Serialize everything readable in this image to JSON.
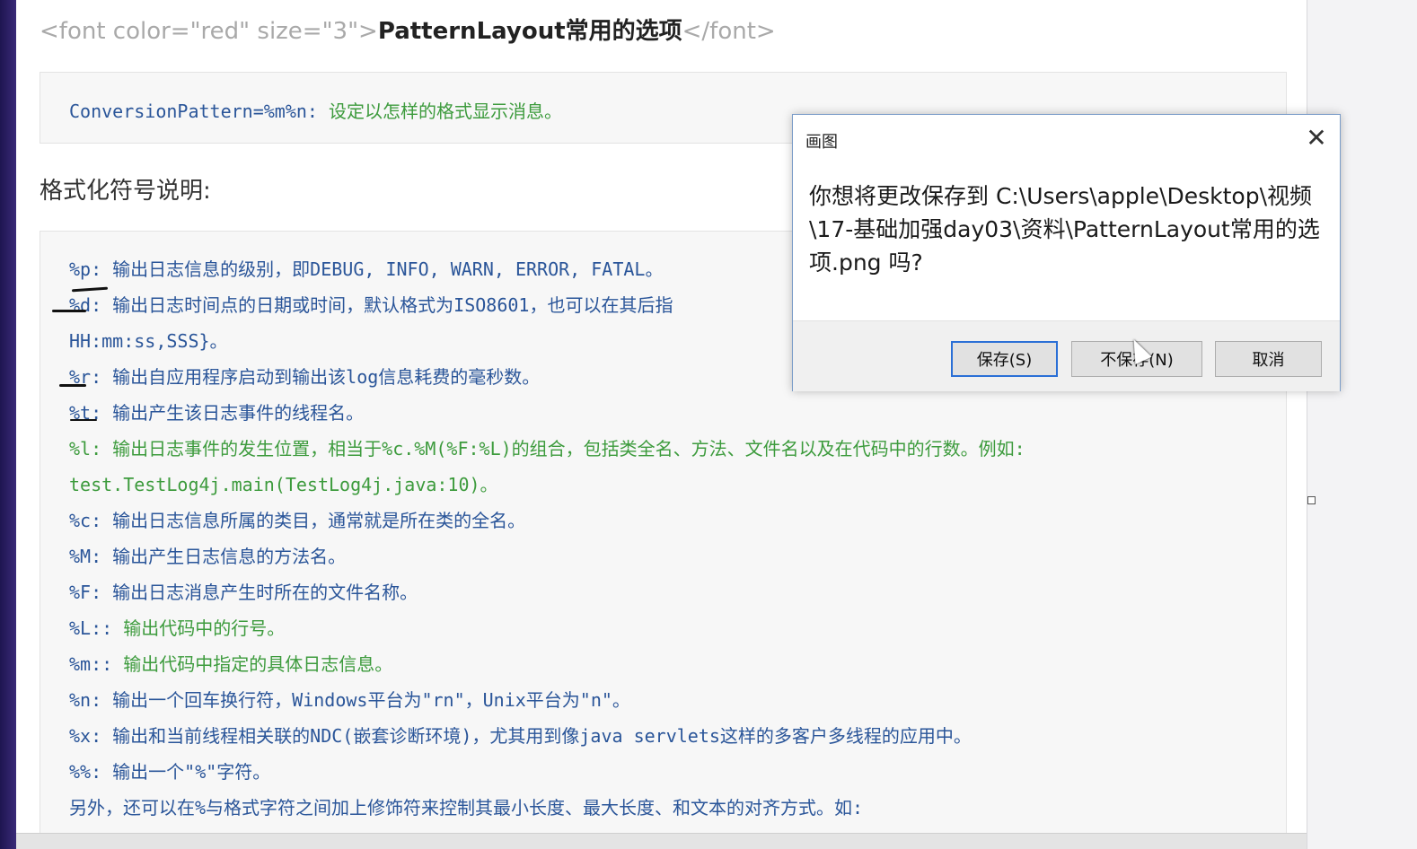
{
  "doc": {
    "heading": {
      "open_tag": "<font color=\"red\" size=\"3\">",
      "title": "PatternLayout常用的选项",
      "close_tag": "</font>"
    },
    "conversion": {
      "key": "ConversionPattern=%m%n:",
      "desc": "设定以怎样的格式显示消息。"
    },
    "section_label": "格式化符号说明:",
    "lines": [
      {
        "key": "%p:",
        "text": "输出日志信息的级别，即DEBUG, INFO, WARN, ERROR, FATAL。"
      },
      {
        "key": "%d:",
        "text": "输出日志时间点的日期或时间，默认格式为ISO8601，也可以在其后指"
      },
      {
        "key": "",
        "text": "HH:mm:ss,SSS}。"
      },
      {
        "key": "%r:",
        "text": "输出自应用程序启动到输出该log信息耗费的毫秒数。"
      },
      {
        "key": "%t:",
        "text": "输出产生该日志事件的线程名。"
      },
      {
        "key": "%l:",
        "text": "输出日志事件的发生位置，相当于%c.%M(%F:%L)的组合，包括类全名、方法、文件名以及在代码中的行数。例如:"
      },
      {
        "key": "",
        "text": "test.TestLog4j.main(TestLog4j.java:10)。"
      },
      {
        "key": "%c:",
        "text": "输出日志信息所属的类目，通常就是所在类的全名。"
      },
      {
        "key": "%M:",
        "text": "输出产生日志信息的方法名。"
      },
      {
        "key": "%F:",
        "text": "输出日志消息产生时所在的文件名称。"
      },
      {
        "key": "%L::",
        "text": "输出代码中的行号。"
      },
      {
        "key": "%m::",
        "text": "输出代码中指定的具体日志信息。"
      },
      {
        "key": "%n:",
        "text": "输出一个回车换行符，Windows平台为\"rn\"，Unix平台为\"n\"。"
      },
      {
        "key": "%x:",
        "text": "输出和当前线程相关联的NDC(嵌套诊断环境)，尤其用到像java servlets这样的多客户多线程的应用中。"
      },
      {
        "key": "%%:",
        "text": "输出一个\"%\"字符。"
      },
      {
        "key": "",
        "text": "另外，还可以在%与格式字符之间加上修饰符来控制其最小长度、最大长度、和文本的对齐方式。如:"
      }
    ]
  },
  "dialog": {
    "title": "画图",
    "message": "你想将更改保存到 C:\\Users\\apple\\Desktop\\视频\\17-基础加强day03\\资料\\PatternLayout常用的选项.png 吗?",
    "buttons": {
      "save": "保存(S)",
      "dont_save": "不保存(N)",
      "cancel": "取消"
    }
  },
  "colors": {
    "code_key": "#2a5599",
    "code_green": "#3d9b3d",
    "dialog_accent": "#2a6fd6"
  }
}
